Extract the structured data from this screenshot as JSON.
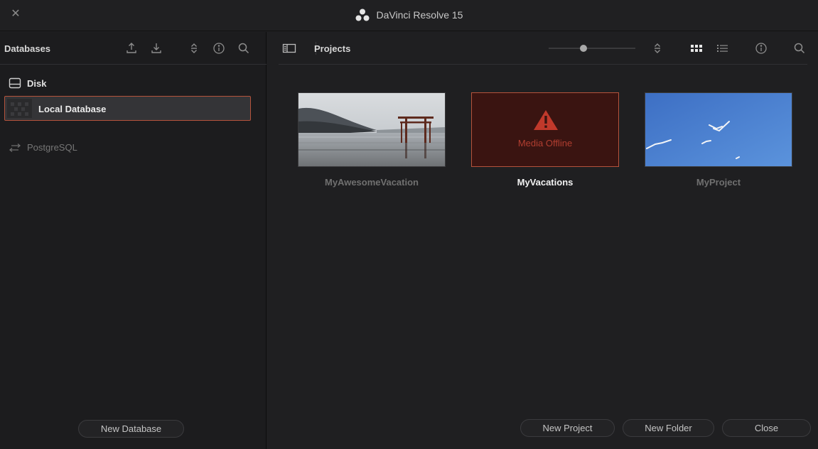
{
  "window": {
    "title": "DaVinci Resolve 15",
    "close_glyph": "✕"
  },
  "databases": {
    "title": "Databases",
    "toolbar_icons": [
      "upload-icon",
      "download-icon",
      "sort-icon",
      "info-icon",
      "search-icon"
    ],
    "disk_group": {
      "label": "Disk",
      "icon": "disk-icon",
      "items": [
        {
          "label": "Local Database",
          "selected": true
        }
      ]
    },
    "network_group": {
      "label": "PostgreSQL",
      "icon": "connection-arrows-icon"
    },
    "new_database_button": "New Database"
  },
  "projects": {
    "title": "Projects",
    "zoom_level": 0.4,
    "view_mode": "grid",
    "toolbar_icons": [
      "sidebar-toggle-icon",
      "sort-icon",
      "grid-view-icon",
      "list-view-icon",
      "info-icon",
      "search-icon"
    ],
    "items": [
      {
        "name": "MyAwesomeVacation",
        "thumbnail": "torii-gate-lake-photo",
        "selected": false
      },
      {
        "name": "MyVacations",
        "thumbnail": "media-offline",
        "offline_text": "Media Offline",
        "selected": true
      },
      {
        "name": "MyProject",
        "thumbnail": "seagulls-blue-sky-photo",
        "selected": false
      }
    ],
    "buttons": {
      "new_project": "New Project",
      "new_folder": "New Folder",
      "close": "Close"
    }
  },
  "colors": {
    "accent_border": "#b5533c",
    "offline_red": "#b13e30",
    "background": "#1f1f21"
  }
}
